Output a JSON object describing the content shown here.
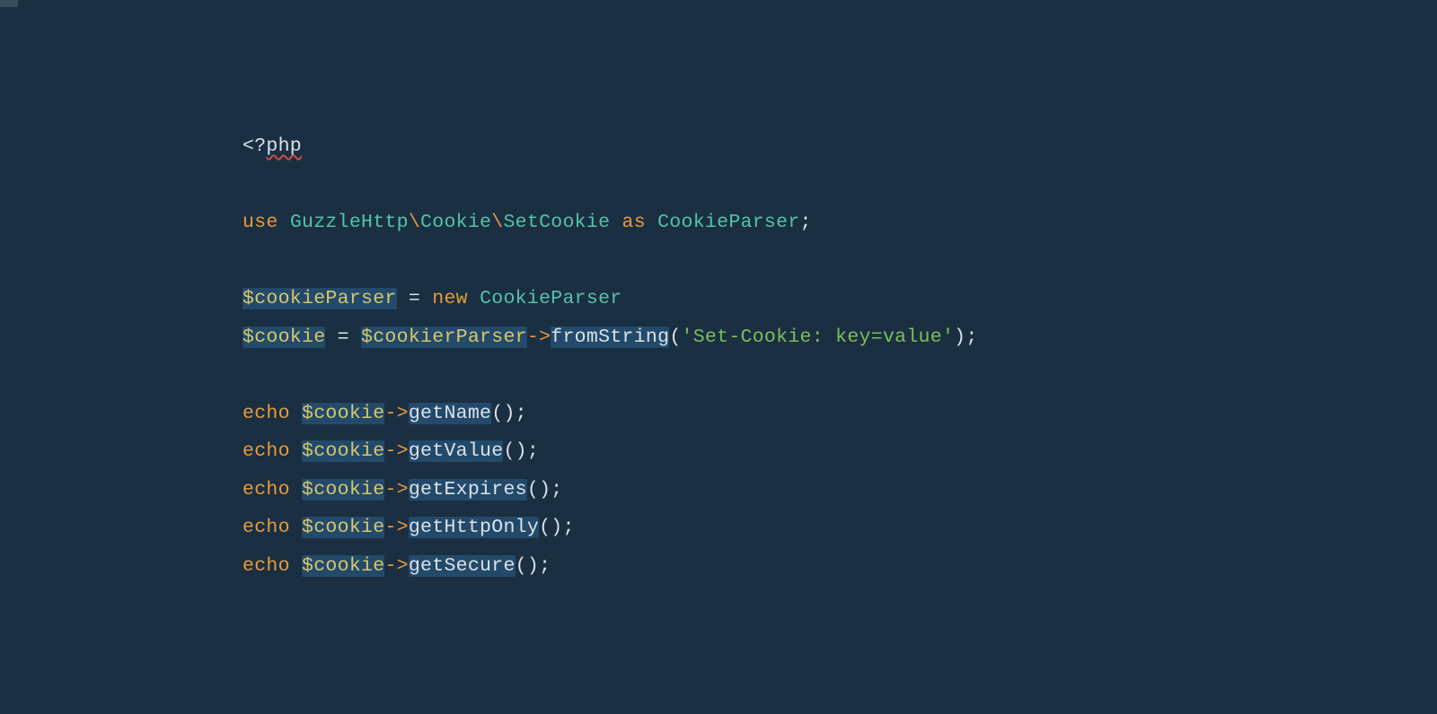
{
  "code": {
    "line1": {
      "open": "<?",
      "php": "php"
    },
    "line3": {
      "use": "use",
      "ns1": "GuzzleHttp",
      "bs1": "\\",
      "ns2": "Cookie",
      "bs2": "\\",
      "class": "SetCookie",
      "as": "as",
      "alias": "CookieParser",
      "semi": ";"
    },
    "line5": {
      "var": "$cookieParser",
      "eq": " = ",
      "new": "new",
      "sp": " ",
      "class": "CookieParser"
    },
    "line6": {
      "var": "$cookie",
      "eq": " = ",
      "var2": "$cookierParser",
      "arrow": "->",
      "method": "fromString",
      "paren1": "(",
      "str": "'Set-Cookie: key=value'",
      "paren2": ")",
      "semi": ";"
    },
    "line8": {
      "echo": "echo",
      "sp": " ",
      "var": "$cookie",
      "arrow": "->",
      "method": "getName",
      "parens": "()",
      "semi": ";"
    },
    "line9": {
      "echo": "echo",
      "sp": " ",
      "var": "$cookie",
      "arrow": "->",
      "method": "getValue",
      "parens": "()",
      "semi": ";"
    },
    "line10": {
      "echo": "echo",
      "sp": " ",
      "var": "$cookie",
      "arrow": "->",
      "method": "getExpires",
      "parens": "()",
      "semi": ";"
    },
    "line11": {
      "echo": "echo",
      "sp": " ",
      "var": "$cookie",
      "arrow": "->",
      "method": "getHttpOnly",
      "parens": "()",
      "semi": ";"
    },
    "line12": {
      "echo": "echo",
      "sp": " ",
      "var": "$cookie",
      "arrow": "->",
      "method": "getSecure",
      "parens": "()",
      "semi": ";"
    }
  }
}
